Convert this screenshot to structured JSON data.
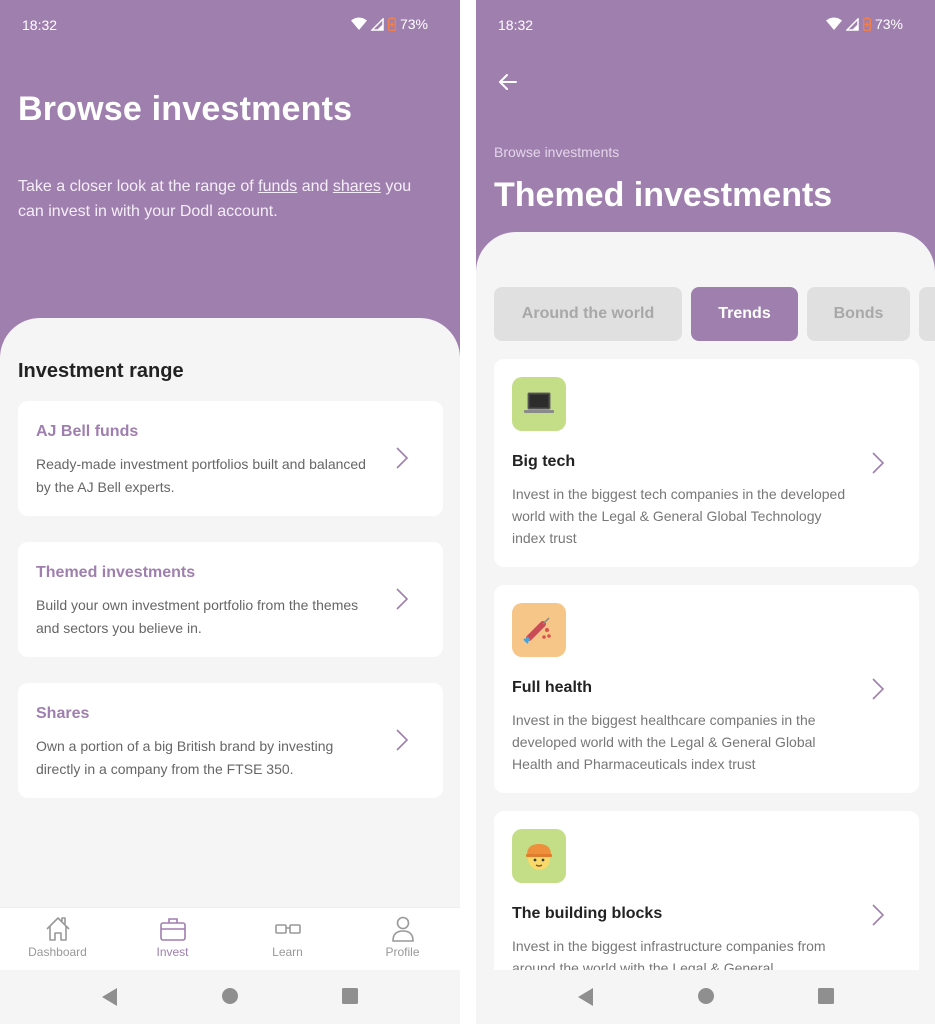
{
  "colors": {
    "brand_purple": "#9f7fae",
    "background": "#f5f5f5",
    "card": "#ffffff",
    "tab_inactive": "#e0e0e0",
    "battery_icon": "#f07f4f",
    "icon_green": "#c3de86",
    "icon_orange": "#f6c689"
  },
  "left_screen": {
    "status_bar": {
      "time": "18:32",
      "battery": "73%",
      "icons": [
        "wifi-icon",
        "signal-icon",
        "battery-saver-icon"
      ]
    },
    "header": {
      "title": "Browse investments",
      "intro_prefix": "Take a closer look at the range of ",
      "intro_link_funds": "funds",
      "intro_middle": " and ",
      "intro_link_shares": "shares",
      "intro_suffix": " you can invest in with your Dodl account."
    },
    "section_title": "Investment range",
    "cards": [
      {
        "title": "AJ Bell funds",
        "description": "Ready-made investment portfolios built and balanced by the AJ Bell experts.",
        "icon": "chevron-right-icon"
      },
      {
        "title": "Themed investments",
        "description": "Build your own investment portfolio from the themes and sectors you believe in.",
        "icon": "chevron-right-icon"
      },
      {
        "title": "Shares",
        "description": "Own a portion of a big British brand by investing directly in a company from the FTSE 350.",
        "icon": "chevron-right-icon"
      }
    ],
    "bottom_nav": [
      {
        "label": "Dashboard",
        "icon": "house-icon",
        "active": false
      },
      {
        "label": "Invest",
        "icon": "briefcase-icon",
        "active": true
      },
      {
        "label": "Learn",
        "icon": "glasses-icon",
        "active": false
      },
      {
        "label": "Profile",
        "icon": "person-icon",
        "active": false
      }
    ],
    "system_nav": [
      "back-triangle-icon",
      "home-circle-icon",
      "recents-square-icon"
    ]
  },
  "right_screen": {
    "status_bar": {
      "time": "18:32",
      "battery": "73%",
      "icons": [
        "wifi-icon",
        "signal-icon",
        "battery-saver-icon"
      ]
    },
    "header": {
      "back_icon": "arrow-left-icon",
      "breadcrumb": "Browse investments",
      "title": "Themed investments"
    },
    "tabs": [
      {
        "label": "Around the world",
        "active": false
      },
      {
        "label": "Trends",
        "active": true
      },
      {
        "label": "Bonds",
        "active": false
      },
      {
        "label": "",
        "active": false
      }
    ],
    "themes": [
      {
        "title": "Big tech",
        "description": "Invest in the biggest tech companies in the developed world with the Legal & General Global Technology index trust",
        "icon": "laptop-icon",
        "icon_bg": "#c3de86"
      },
      {
        "title": "Full health",
        "description": "Invest in the biggest healthcare companies in the developed world with the Legal & General Global Health and Pharmaceuticals index trust",
        "icon": "syringe-icon",
        "icon_bg": "#f6c689"
      },
      {
        "title": "The building blocks",
        "description": "Invest in the biggest infrastructure companies from around the world with the Legal & General",
        "icon": "construction-worker-icon",
        "icon_bg": "#c3de86"
      }
    ],
    "system_nav": [
      "back-triangle-icon",
      "home-circle-icon",
      "recents-square-icon"
    ]
  }
}
